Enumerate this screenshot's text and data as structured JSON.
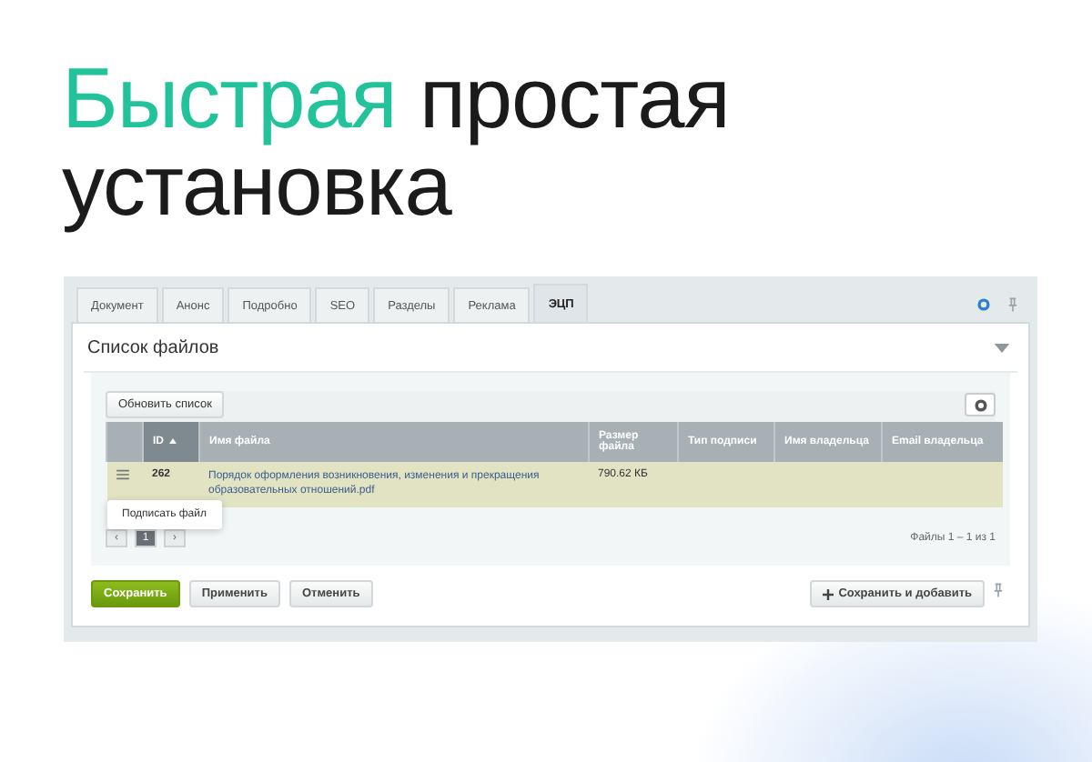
{
  "headline": {
    "accent": "Быстрая",
    "text": "простая установка"
  },
  "tabs": [
    {
      "label": "Документ",
      "selected": false
    },
    {
      "label": "Анонс",
      "selected": false
    },
    {
      "label": "Подробно",
      "selected": false
    },
    {
      "label": "SEO",
      "selected": false
    },
    {
      "label": "Разделы",
      "selected": false
    },
    {
      "label": "Реклама",
      "selected": false
    },
    {
      "label": "ЭЦП",
      "selected": true
    }
  ],
  "section": {
    "title": "Список файлов",
    "expanded": true
  },
  "toolbar": {
    "refresh_button": "Обновить список"
  },
  "table": {
    "columns": [
      {
        "label": "ID",
        "sorted": true
      },
      {
        "label": "Имя файла",
        "sorted": false
      },
      {
        "label": "Размер файла",
        "sorted": false
      },
      {
        "label": "Тип подписи",
        "sorted": false
      },
      {
        "label": "Имя владельца",
        "sorted": false
      },
      {
        "label": "Email владельца",
        "sorted": false
      }
    ],
    "rows": [
      {
        "id": "262",
        "name": "Порядок оформления возникновения, изменения и прекращения образовательных отношений.pdf",
        "size": "790.62 КБ",
        "selected": true
      }
    ]
  },
  "context_menu": {
    "items": [
      "Подписать файл"
    ]
  },
  "pager": {
    "prev": "‹",
    "pages": [
      {
        "label": "1",
        "selected": true
      }
    ],
    "next": "›",
    "summary": "Файлы 1 – 1 из 1"
  },
  "buttons": [
    {
      "label": "Сохранить",
      "kind": "primary"
    },
    {
      "label": "Применить",
      "kind": "plain"
    },
    {
      "label": "Отменить",
      "kind": "plain"
    }
  ],
  "save_add_button": "Сохранить и добавить"
}
